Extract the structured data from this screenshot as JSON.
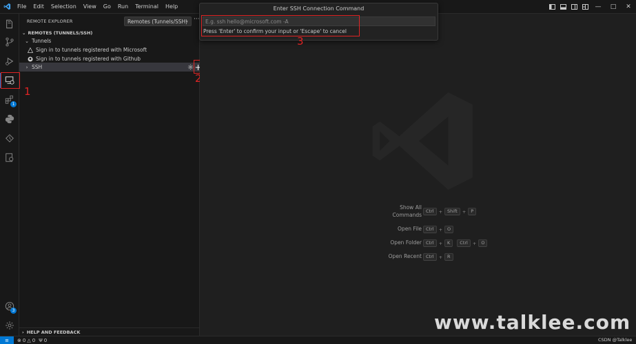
{
  "menu": [
    "File",
    "Edit",
    "Selection",
    "View",
    "Go",
    "Run",
    "Terminal",
    "Help"
  ],
  "colors": {
    "accent": "#0078d4",
    "annotation": "#e02424",
    "background": "#1f1f1f",
    "sidebar": "#181818"
  },
  "sidebar": {
    "header": "REMOTE EXPLORER",
    "remote_select": "Remotes (Tunnels/SSH)",
    "more": "···",
    "section": "REMOTES (TUNNELS/SSH)",
    "tunnels_label": "Tunnels",
    "items": [
      {
        "label": "Sign in to tunnels registered with Microsoft",
        "icon": "microsoft-icon"
      },
      {
        "label": "Sign in to tunnels registered with Github",
        "icon": "github-icon"
      }
    ],
    "ssh_label": "SSH",
    "help_section": "HELP AND FEEDBACK"
  },
  "activity_badges": {
    "extensions": "1",
    "accounts": "3"
  },
  "annotations": [
    "1",
    "2",
    "3"
  ],
  "quick_input": {
    "title": "Enter SSH Connection Command",
    "placeholder": "E.g. ssh hello@microsoft.com -A",
    "message": "Press 'Enter' to confirm your input or 'Escape' to cancel"
  },
  "shortcuts": [
    {
      "label": "Show All Commands",
      "keys": [
        "Ctrl",
        "+",
        "Shift",
        "+",
        "P"
      ]
    },
    {
      "label": "Open File",
      "keys": [
        "Ctrl",
        "+",
        "O"
      ]
    },
    {
      "label": "Open Folder",
      "keys": [
        "Ctrl",
        "+",
        "K",
        " ",
        "Ctrl",
        "+",
        "O"
      ]
    },
    {
      "label": "Open Recent",
      "keys": [
        "Ctrl",
        "+",
        "R"
      ]
    }
  ],
  "status": {
    "errors": "0",
    "warnings": "0",
    "ports": "0"
  },
  "watermark": "www.talklee.com",
  "csdn": "CSDN @Talklee"
}
